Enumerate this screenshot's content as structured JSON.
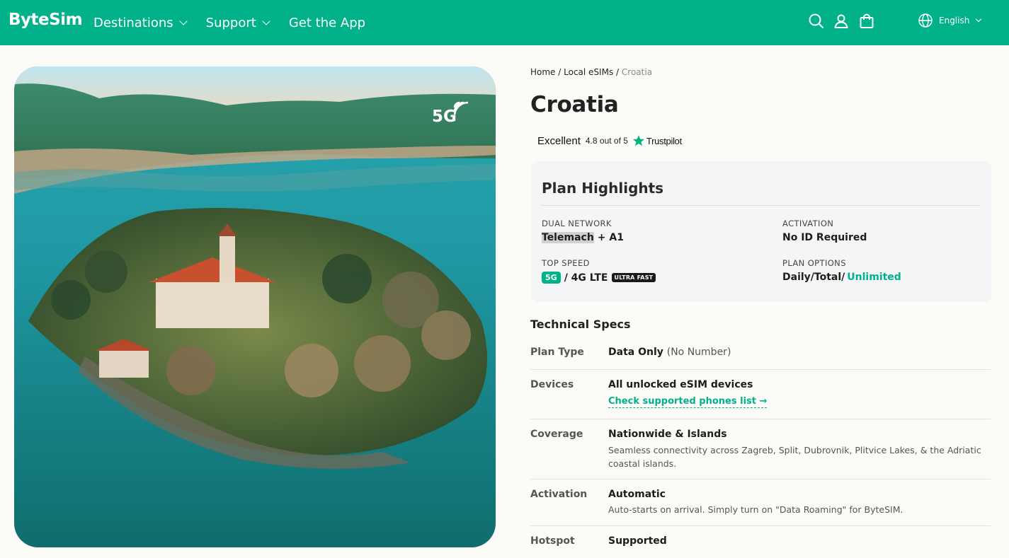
{
  "header": {
    "logo": "ByteSim",
    "nav": [
      {
        "label": "Destinations",
        "has_dropdown": true
      },
      {
        "label": "Support",
        "has_dropdown": true
      },
      {
        "label": "Get the App",
        "has_dropdown": false
      }
    ],
    "icons": [
      "search-icon",
      "user-icon",
      "shopping-bag-icon",
      "globe-icon"
    ],
    "language": "English",
    "brand_color": "#00b189"
  },
  "hero": {
    "badge": "5G",
    "image_description": "Aerial photo of an island monastery in a turquoise lake surrounded by forested hills"
  },
  "breadcrumb": {
    "home": "Home",
    "sep1": "/",
    "local": "Local eSIMs",
    "sep2": "/",
    "current": "Croatia"
  },
  "title": "Croatia",
  "rating": {
    "label": "Excellent",
    "score": "4.8 out of 5",
    "provider": "Trustpilot"
  },
  "highlights": {
    "title": "Plan Highlights",
    "network_label": "DUAL NETWORK",
    "network_primary": "Telemach",
    "network_rest": "+ A1",
    "activation_label": "ACTIVATION",
    "activation_value": "No ID Required",
    "speed_label": "TOP SPEED",
    "speed_5g": "5G",
    "speed_rest": "/ 4G LTE",
    "speed_badge": "ULTRA FAST",
    "options_label": "PLAN OPTIONS",
    "options_value": "Daily/Total/",
    "options_accent": "Unlimited"
  },
  "specs": {
    "heading": "Technical Specs",
    "plan_type_label": "Plan Type",
    "plan_type_value": "Data Only",
    "plan_type_note": "(No Number)",
    "devices_label": "Devices",
    "devices_value": "All unlocked eSIM devices",
    "devices_link": "Check supported phones list →",
    "coverage_label": "Coverage",
    "coverage_value": "Nationwide & Islands",
    "coverage_sub": "Seamless connectivity across Zagreb, Split, Dubrovnik, Plitvice Lakes, & the Adriatic coastal islands.",
    "activation_label": "Activation",
    "activation_value": "Automatic",
    "activation_sub": "Auto-starts on arrival. Simply turn on \"Data Roaming\" for ByteSIM.",
    "hotspot_label": "Hotspot",
    "hotspot_value": "Supported"
  }
}
